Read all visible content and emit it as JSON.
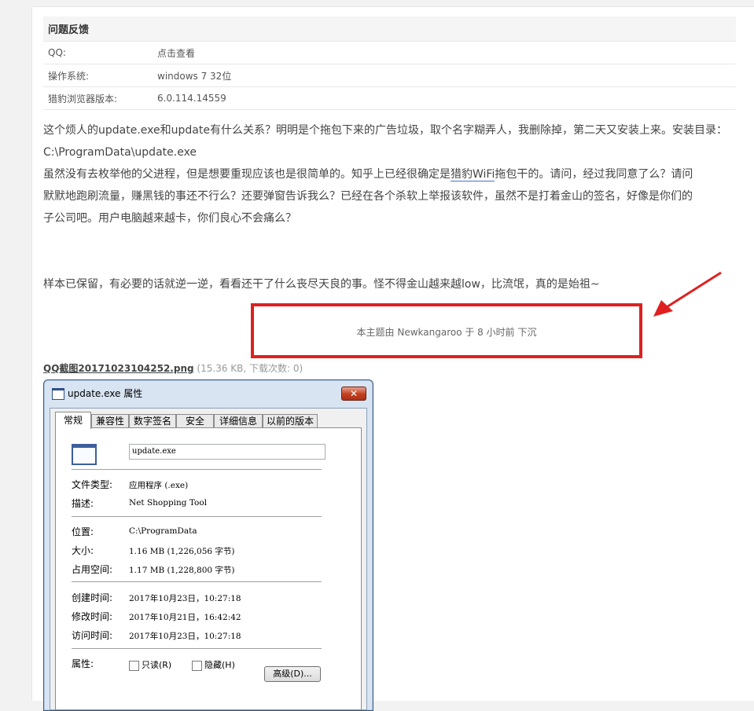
{
  "info": {
    "heading": "问题反馈",
    "rows": [
      {
        "label": "QQ:",
        "value": "点击查看"
      },
      {
        "label": "操作系统:",
        "value": "windows 7 32位"
      },
      {
        "label": "猎豹浏览器版本:",
        "value": "6.0.114.14559"
      }
    ]
  },
  "post": {
    "line1": "这个烦人的update.exe和update有什么关系？明明是个拖包下来的广告垃圾，取个名字糊弄人，我删除掉，第二天又安装上来。安装目录：",
    "line2": "C:\\ProgramData\\update.exe",
    "line3_before": "虽然没有去枚举他的父进程，但是想要重现应该也是很简单的。知乎上已经很确定是",
    "keyword": "猎豹WiFi",
    "line3_after": "拖包干的。请问，经过我同意了么？请问",
    "line4": "默默地跑刷流量，赚黑钱的事还不行么？还要弹窗告诉我么？已经在各个杀软上举报该软件，虽然不是打着金山的签名，好像是你们的",
    "line5": "子公司吧。用户电脑越来越卡，你们良心不会痛么？",
    "line6": "样本已保留，有必要的话就逆一逆，看看还干了什么丧尽天良的事。怪不得金山越来越low，比流氓，真的是始祖~"
  },
  "notice": "本主题由 Newkangaroo 于 8 小时前 下沉",
  "attachment": {
    "filename": "QQ截图20171023104252.png",
    "meta": "(15.36 KB, 下载次数: 0)"
  },
  "dialog": {
    "title": "update.exe 属性",
    "close": "✕",
    "tabs": [
      "常规",
      "兼容性",
      "数字签名",
      "安全",
      "详细信息",
      "以前的版本"
    ],
    "filename": "update.exe",
    "props": [
      {
        "label": "文件类型:",
        "value": "应用程序 (.exe)"
      },
      {
        "label": "描述:",
        "value": "Net Shopping Tool"
      },
      {
        "label": "位置:",
        "value": "C:\\ProgramData"
      },
      {
        "label": "大小:",
        "value": "1.16 MB (1,226,056 字节)"
      },
      {
        "label": "占用空间:",
        "value": "1.17 MB (1,228,800 字节)"
      },
      {
        "label": "创建时间:",
        "value": "2017年10月23日，10:27:18"
      },
      {
        "label": "修改时间:",
        "value": "2017年10月21日，16:42:42"
      },
      {
        "label": "访问时间:",
        "value": "2017年10月23日，10:27:18"
      }
    ],
    "attr_label": "属性:",
    "readonly": "只读(R)",
    "hidden": "隐藏(H)",
    "advanced": "高级(D)..."
  },
  "colors": {
    "highlight_border": "#e02020",
    "arrow": "#e02020"
  },
  "icons": [
    "window-icon",
    "close-icon",
    "file-icon",
    "red-arrow-icon"
  ]
}
